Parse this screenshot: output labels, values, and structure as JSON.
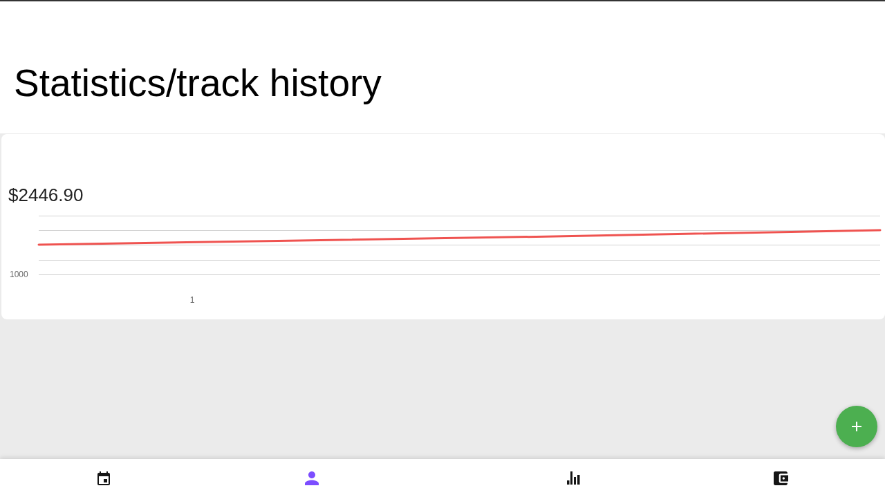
{
  "header": {
    "title": "Statistics/track history"
  },
  "balance_card": {
    "amount": "$2446.90",
    "chart": {
      "y_tick": "1000",
      "x_tick": "1"
    }
  },
  "bottom_nav": [
    {
      "selected": false
    },
    {
      "selected": true
    },
    {
      "selected": false
    },
    {
      "selected": false
    }
  ]
}
